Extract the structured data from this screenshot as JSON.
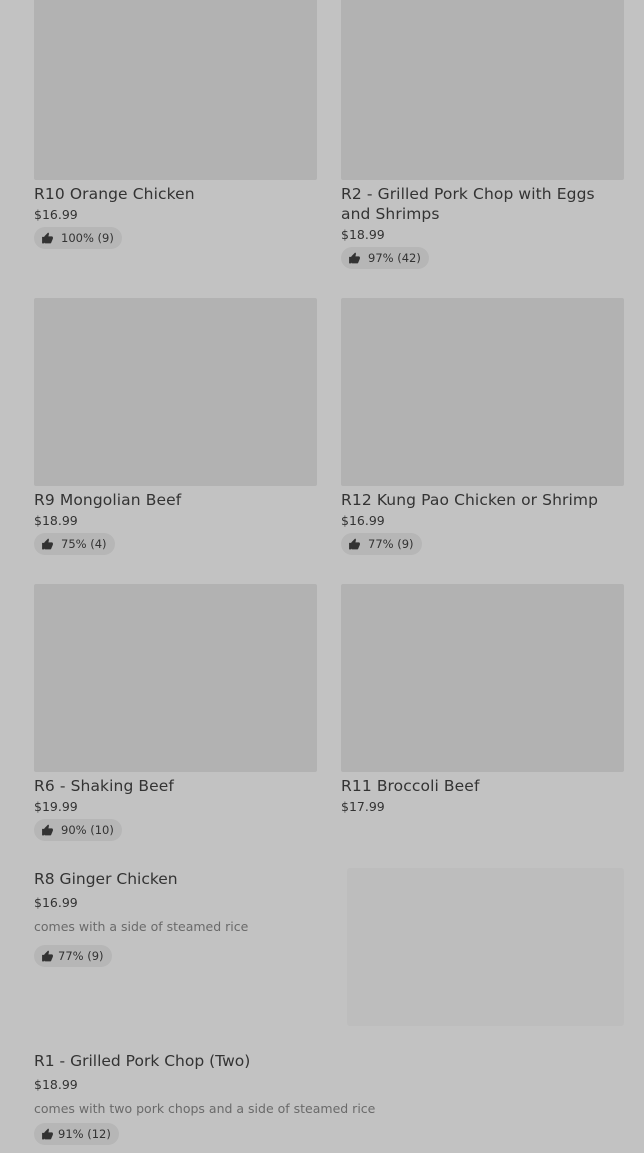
{
  "grid_items": [
    {
      "name": "R10 Orange Chicken",
      "price": "$16.99",
      "rating": "100% (9)"
    },
    {
      "name": "R2 - Grilled Pork Chop with Eggs and Shrimps",
      "price": "$18.99",
      "rating": "97% (42)"
    },
    {
      "name": "R9 Mongolian Beef",
      "price": "$18.99",
      "rating": "75% (4)"
    },
    {
      "name": "R12 Kung Pao Chicken or Shrimp",
      "price": "$16.99",
      "rating": "77% (9)"
    },
    {
      "name": "R6 - Shaking Beef",
      "price": "$19.99",
      "rating": "90% (10)"
    },
    {
      "name": "R11 Broccoli Beef",
      "price": "$17.99"
    }
  ],
  "list_items": [
    {
      "name": "R8 Ginger Chicken",
      "price": "$16.99",
      "description": "comes with a side of steamed rice",
      "rating": "77% (9)"
    },
    {
      "name": "R1 - Grilled Pork Chop (Two)",
      "price": "$18.99",
      "description": "comes with two pork chops and a side of steamed rice",
      "rating": "91% (12)"
    }
  ],
  "icons": {
    "rating": "thumbs-up-icon"
  },
  "colors": {
    "background": "#c2c2c2",
    "image_placeholder": "#b2b2b2",
    "badge": "#b6b6b6",
    "text": "#333333",
    "muted_text": "#6a6a6a"
  }
}
